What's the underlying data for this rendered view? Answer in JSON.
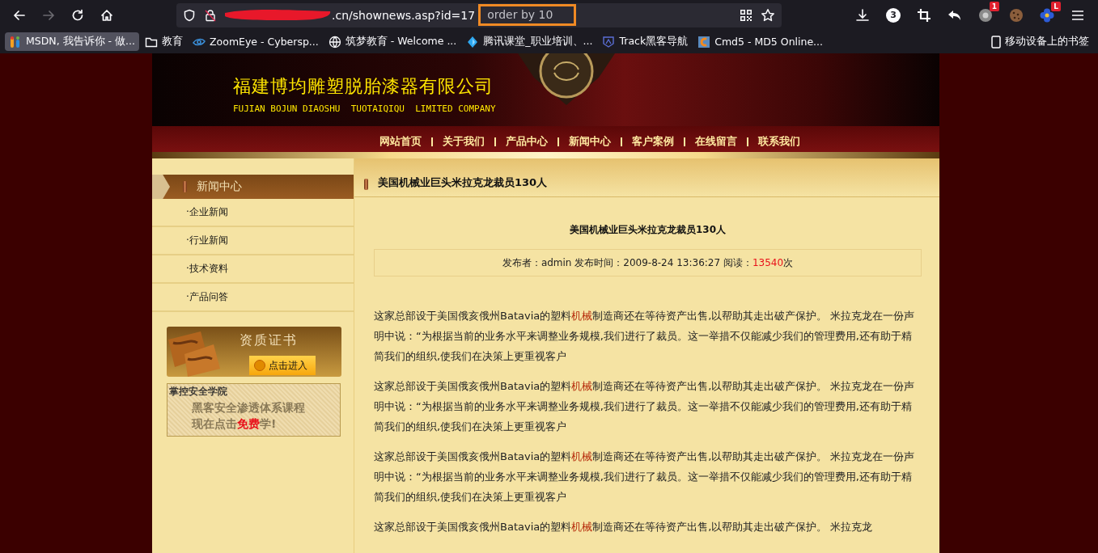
{
  "browser": {
    "nav": [
      {
        "kind": "back",
        "disabled": false
      },
      {
        "kind": "forward",
        "disabled": true
      },
      {
        "kind": "reload",
        "disabled": false
      },
      {
        "kind": "home",
        "disabled": false
      }
    ],
    "url": {
      "text": ".cn/shownews.asp?id=17",
      "highlight": "order by 10"
    },
    "toolbar": [
      {
        "kind": "download"
      },
      {
        "kind": "count",
        "badge": "3"
      },
      {
        "kind": "crop"
      },
      {
        "kind": "undo"
      },
      {
        "kind": "ext",
        "badge": "1"
      },
      {
        "kind": "cookie"
      },
      {
        "kind": "flower",
        "badge": "L"
      },
      {
        "kind": "menu"
      }
    ],
    "bookmarks": [
      {
        "kind": "msdn",
        "label": "MSDN, 我告诉你 - 做...",
        "selected": true
      },
      {
        "kind": "folder",
        "label": "教育",
        "selected": false
      },
      {
        "kind": "eye",
        "label": "ZoomEye - Cybersp...",
        "selected": false
      },
      {
        "kind": "globe",
        "label": "筑梦教育 - Welcome ...",
        "selected": false
      },
      {
        "kind": "diamond",
        "label": "腾讯课堂_职业培训、...",
        "selected": false
      },
      {
        "kind": "shield",
        "label": "Track黑客导航",
        "selected": false
      },
      {
        "kind": "cmd5",
        "label": "Cmd5 - MD5 Online...",
        "selected": false
      }
    ],
    "mobile_bookmarks": "移动设备上的书签"
  },
  "site": {
    "title": "福建博均雕塑脱胎漆器有限公司",
    "subtitle": "FUJIAN BOJUN DIAOSHU  TUOTAIQIQU  LIMITED COMPANY",
    "nav": [
      "网站首页",
      "关于我们",
      "产品中心",
      "新闻中心",
      "客户案例",
      "在线留言",
      "联系我们"
    ]
  },
  "sidebar": {
    "heading": "新闻中心",
    "items": [
      "·企业新闻",
      "·行业新闻",
      "·技术资料",
      "·产品问答"
    ],
    "certificate": {
      "title": "资质证书",
      "button": "点击进入"
    },
    "ad": {
      "brand": "掌控安全学院",
      "line1": "黑客安全渗透体系课程",
      "line2": [
        {
          "text": "现在点击",
          "highlight": false
        },
        {
          "text": "免费",
          "highlight": true
        },
        {
          "text": "学!",
          "highlight": false
        }
      ]
    }
  },
  "article": {
    "section_title": "美国机械业巨头米拉克龙裁员130人",
    "title": "美国机械业巨头米拉克龙裁员130人",
    "meta": {
      "prefix": "发布者：admin 发布时间：2009-8-24 13:36:27 阅读：",
      "count": "13540",
      "suffix": "次"
    },
    "paragraphs": [
      [
        {
          "text": "这家总部设于美国俄亥俄州Batavia的塑料",
          "highlight": false
        },
        {
          "text": "机械",
          "highlight": true
        },
        {
          "text": "制造商还在等待资产出售,以帮助其走出破产保护。 米拉克龙在一份声明中说：“为根据当前的业务水平来调整业务规模,我们进行了裁员。这一举措不仅能减少我们的管理费用,还有助于精简我们的组织,使我们在决策上更重视客户",
          "highlight": false
        }
      ],
      [
        {
          "text": "这家总部设于美国俄亥俄州Batavia的塑料",
          "highlight": false
        },
        {
          "text": "机械",
          "highlight": true
        },
        {
          "text": "制造商还在等待资产出售,以帮助其走出破产保护。 米拉克龙在一份声明中说：“为根据当前的业务水平来调整业务规模,我们进行了裁员。这一举措不仅能减少我们的管理费用,还有助于精简我们的组织,使我们在决策上更重视客户",
          "highlight": false
        }
      ],
      [
        {
          "text": "这家总部设于美国俄亥俄州Batavia的塑料",
          "highlight": false
        },
        {
          "text": "机械",
          "highlight": true
        },
        {
          "text": "制造商还在等待资产出售,以帮助其走出破产保护。 米拉克龙在一份声明中说：“为根据当前的业务水平来调整业务规模,我们进行了裁员。这一举措不仅能减少我们的管理费用,还有助于精简我们的组织,使我们在决策上更重视客户",
          "highlight": false
        }
      ],
      [
        {
          "text": "这家总部设于美国俄亥俄州Batavia的塑料",
          "highlight": false
        },
        {
          "text": "机械",
          "highlight": true
        },
        {
          "text": "制造商还在等待资产出售,以帮助其走出破产保护。 米拉克龙",
          "highlight": false
        }
      ]
    ]
  }
}
